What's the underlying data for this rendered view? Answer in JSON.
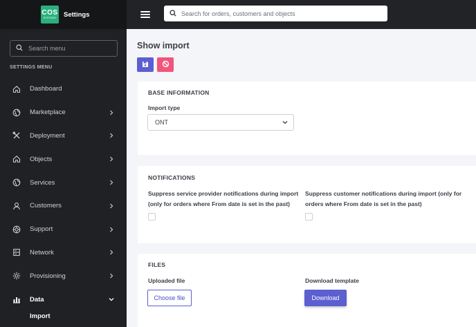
{
  "brand": {
    "logo_main": "COS",
    "logo_sub": "SYSTEMS",
    "title": "Settings"
  },
  "sidebar": {
    "search_placeholder": "Search menu",
    "heading": "SETTINGS MENU",
    "items": [
      {
        "label": "Dashboard",
        "icon": "home-icon",
        "has_chevron": false
      },
      {
        "label": "Marketplace",
        "icon": "globe-icon",
        "has_chevron": true
      },
      {
        "label": "Deployment",
        "icon": "tools-icon",
        "has_chevron": true
      },
      {
        "label": "Objects",
        "icon": "home-icon",
        "has_chevron": true
      },
      {
        "label": "Services",
        "icon": "globe-icon",
        "has_chevron": true
      },
      {
        "label": "Customers",
        "icon": "user-icon",
        "has_chevron": true
      },
      {
        "label": "Support",
        "icon": "lifebuoy-icon",
        "has_chevron": true
      },
      {
        "label": "Network",
        "icon": "server-icon",
        "has_chevron": true
      },
      {
        "label": "Provisioning",
        "icon": "gear-icon",
        "has_chevron": true
      },
      {
        "label": "Data",
        "icon": "chart-icon",
        "has_chevron": true,
        "open": true
      }
    ],
    "subitems": [
      {
        "label": "Import"
      }
    ]
  },
  "topbar": {
    "search_placeholder": "Search for orders, customers and objects"
  },
  "page": {
    "title": "Show import"
  },
  "base_info": {
    "heading": "BASE INFORMATION",
    "import_type_label": "Import type",
    "import_type_value": "ONT"
  },
  "notifications": {
    "heading": "NOTIFICATIONS",
    "provider_label": "Suppress service provider notifications during import (only for orders where From date is set in the past)",
    "customer_label": "Suppress customer notifications during import (only for orders where From date is set in the past)"
  },
  "files": {
    "heading": "FILES",
    "uploaded_label": "Uploaded file",
    "choose_button": "Choose file",
    "download_label": "Download template",
    "download_button": "Download"
  },
  "colors": {
    "sidebar_bg": "#1f2124",
    "accent": "#5b5fd0",
    "danger": "#f0557a",
    "brand": "#2bb07f"
  }
}
